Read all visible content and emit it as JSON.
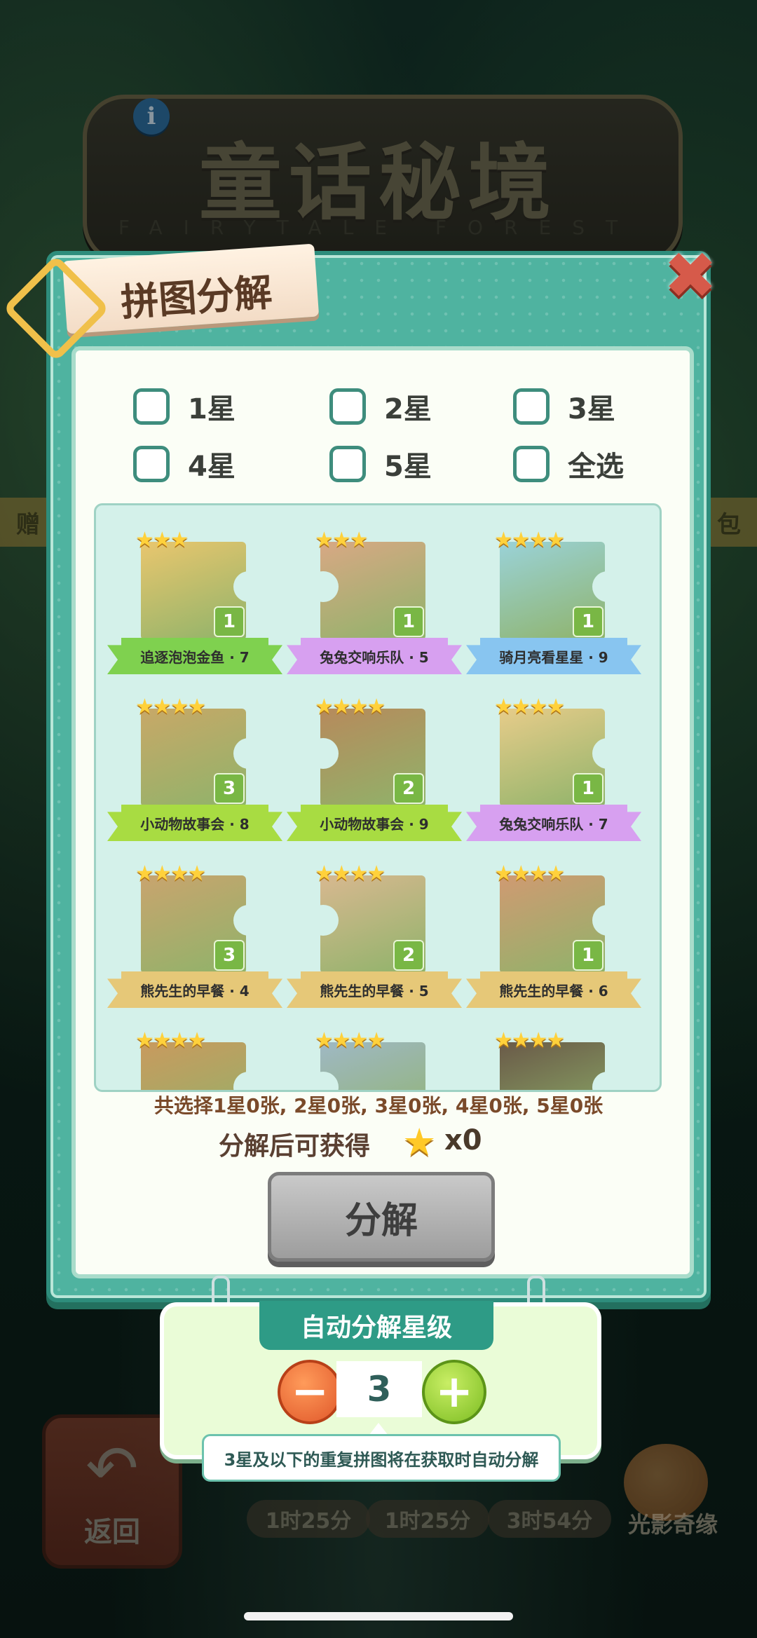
{
  "header": {
    "title": "童话秘境",
    "subtitle": "FAIRYTALE FOREST",
    "left_tag": "赠",
    "right_tag": "包"
  },
  "modal": {
    "title": "拼图分解",
    "filters": [
      {
        "label": "1星"
      },
      {
        "label": "2星"
      },
      {
        "label": "3星"
      },
      {
        "label": "4星"
      },
      {
        "label": "5星"
      },
      {
        "label": "全选"
      }
    ],
    "cards": [
      {
        "label": "追逐泡泡金鱼 · 7",
        "stars": 3,
        "count": "1",
        "ribbon": "#7fd14f",
        "art": "#e9c66e"
      },
      {
        "label": "兔兔交响乐队 · 5",
        "stars": 3,
        "count": "1",
        "ribbon": "#d7a0f0",
        "art": "#d8a884"
      },
      {
        "label": "骑月亮看星星 · 9",
        "stars": 4,
        "count": "1",
        "ribbon": "#88c5f0",
        "art": "#9ad2d8"
      },
      {
        "label": "小动物故事会 · 8",
        "stars": 4,
        "count": "3",
        "ribbon": "#a8dc42",
        "art": "#c8a868"
      },
      {
        "label": "小动物故事会 · 9",
        "stars": 4,
        "count": "2",
        "ribbon": "#a8dc42",
        "art": "#b78a5c"
      },
      {
        "label": "兔兔交响乐队 · 7",
        "stars": 4,
        "count": "1",
        "ribbon": "#d7a0f0",
        "art": "#e7cc8a"
      },
      {
        "label": "熊先生的早餐 · 4",
        "stars": 4,
        "count": "3",
        "ribbon": "#e6c878",
        "art": "#c9a46e"
      },
      {
        "label": "熊先生的早餐 · 5",
        "stars": 4,
        "count": "2",
        "ribbon": "#e6c878",
        "art": "#d8b890"
      },
      {
        "label": "熊先生的早餐 · 6",
        "stars": 4,
        "count": "1",
        "ribbon": "#e6c878",
        "art": "#d09a72"
      },
      {
        "label": "",
        "stars": 4,
        "count": "",
        "ribbon": "",
        "art": "#c99a5e"
      },
      {
        "label": "",
        "stars": 4,
        "count": "",
        "ribbon": "",
        "art": "#9fb8c4"
      },
      {
        "label": "",
        "stars": 4,
        "count": "",
        "ribbon": "",
        "art": "#6a5a48"
      }
    ],
    "summary": "共选择1星0张, 2星0张, 3星0张, 4星0张, 5星0张",
    "reward_label": "分解后可获得",
    "reward_count": "x0",
    "decompose_label": "分解"
  },
  "auto_decompose": {
    "title": "自动分解星级",
    "level": "3",
    "minus_label": "−",
    "plus_label": "+",
    "tooltip": "3星及以下的重复拼图将在获取时自动分解"
  },
  "bottom_nav": {
    "back_label": "返回",
    "timers": [
      "1时25分",
      "1时25分",
      "3时54分"
    ],
    "mascot_label": "光影奇缘"
  },
  "colors": {
    "modal_teal": "#4fb3a0",
    "close_red": "#d65a4a",
    "star_yellow": "#ffd13b",
    "minus_orange": "#e0572a",
    "plus_green": "#7cbd22"
  }
}
